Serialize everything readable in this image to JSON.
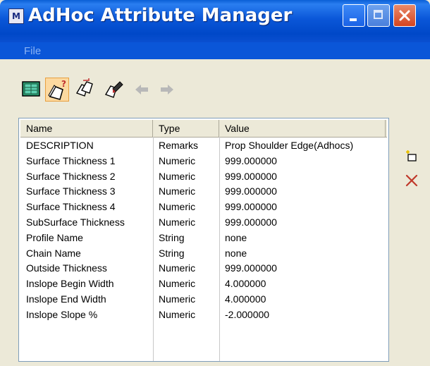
{
  "window": {
    "title": "AdHoc Attribute Manager",
    "app_icon_glyph": "M",
    "buttons": {
      "minimize": "minimize-icon",
      "maximize": "maximize-icon",
      "close": "close-icon"
    }
  },
  "menu": {
    "file": "File"
  },
  "toolbar": {
    "items": [
      {
        "name": "table-view-icon"
      },
      {
        "name": "query-attributes-icon"
      },
      {
        "name": "copy-attributes-icon"
      },
      {
        "name": "paint-attributes-icon"
      },
      {
        "name": "back-arrow-icon"
      },
      {
        "name": "forward-arrow-icon"
      }
    ]
  },
  "table": {
    "columns": [
      "Name",
      "Type",
      "Value"
    ],
    "rows": [
      [
        "DESCRIPTION",
        "Remarks",
        "Prop Shoulder Edge(Adhocs)"
      ],
      [
        "Surface Thickness 1",
        "Numeric",
        "999.000000"
      ],
      [
        "Surface Thickness 2",
        "Numeric",
        "999.000000"
      ],
      [
        "Surface Thickness 3",
        "Numeric",
        "999.000000"
      ],
      [
        "Surface Thickness 4",
        "Numeric",
        "999.000000"
      ],
      [
        "SubSurface Thickness",
        "Numeric",
        "999.000000"
      ],
      [
        "Profile Name",
        "String",
        "none"
      ],
      [
        "Chain Name",
        "String",
        "none"
      ],
      [
        "Outside Thickness",
        "Numeric",
        "999.000000"
      ],
      [
        "Inslope Begin Width",
        "Numeric",
        "4.000000"
      ],
      [
        "Inslope End Width",
        "Numeric",
        "4.000000"
      ],
      [
        "Inslope Slope %",
        "Numeric",
        "-2.000000"
      ]
    ]
  },
  "side_actions": {
    "add": "add-row-icon",
    "delete": "delete-row-icon"
  },
  "colors": {
    "titlebar": "#0a56d8",
    "delete": "#c0392b"
  }
}
